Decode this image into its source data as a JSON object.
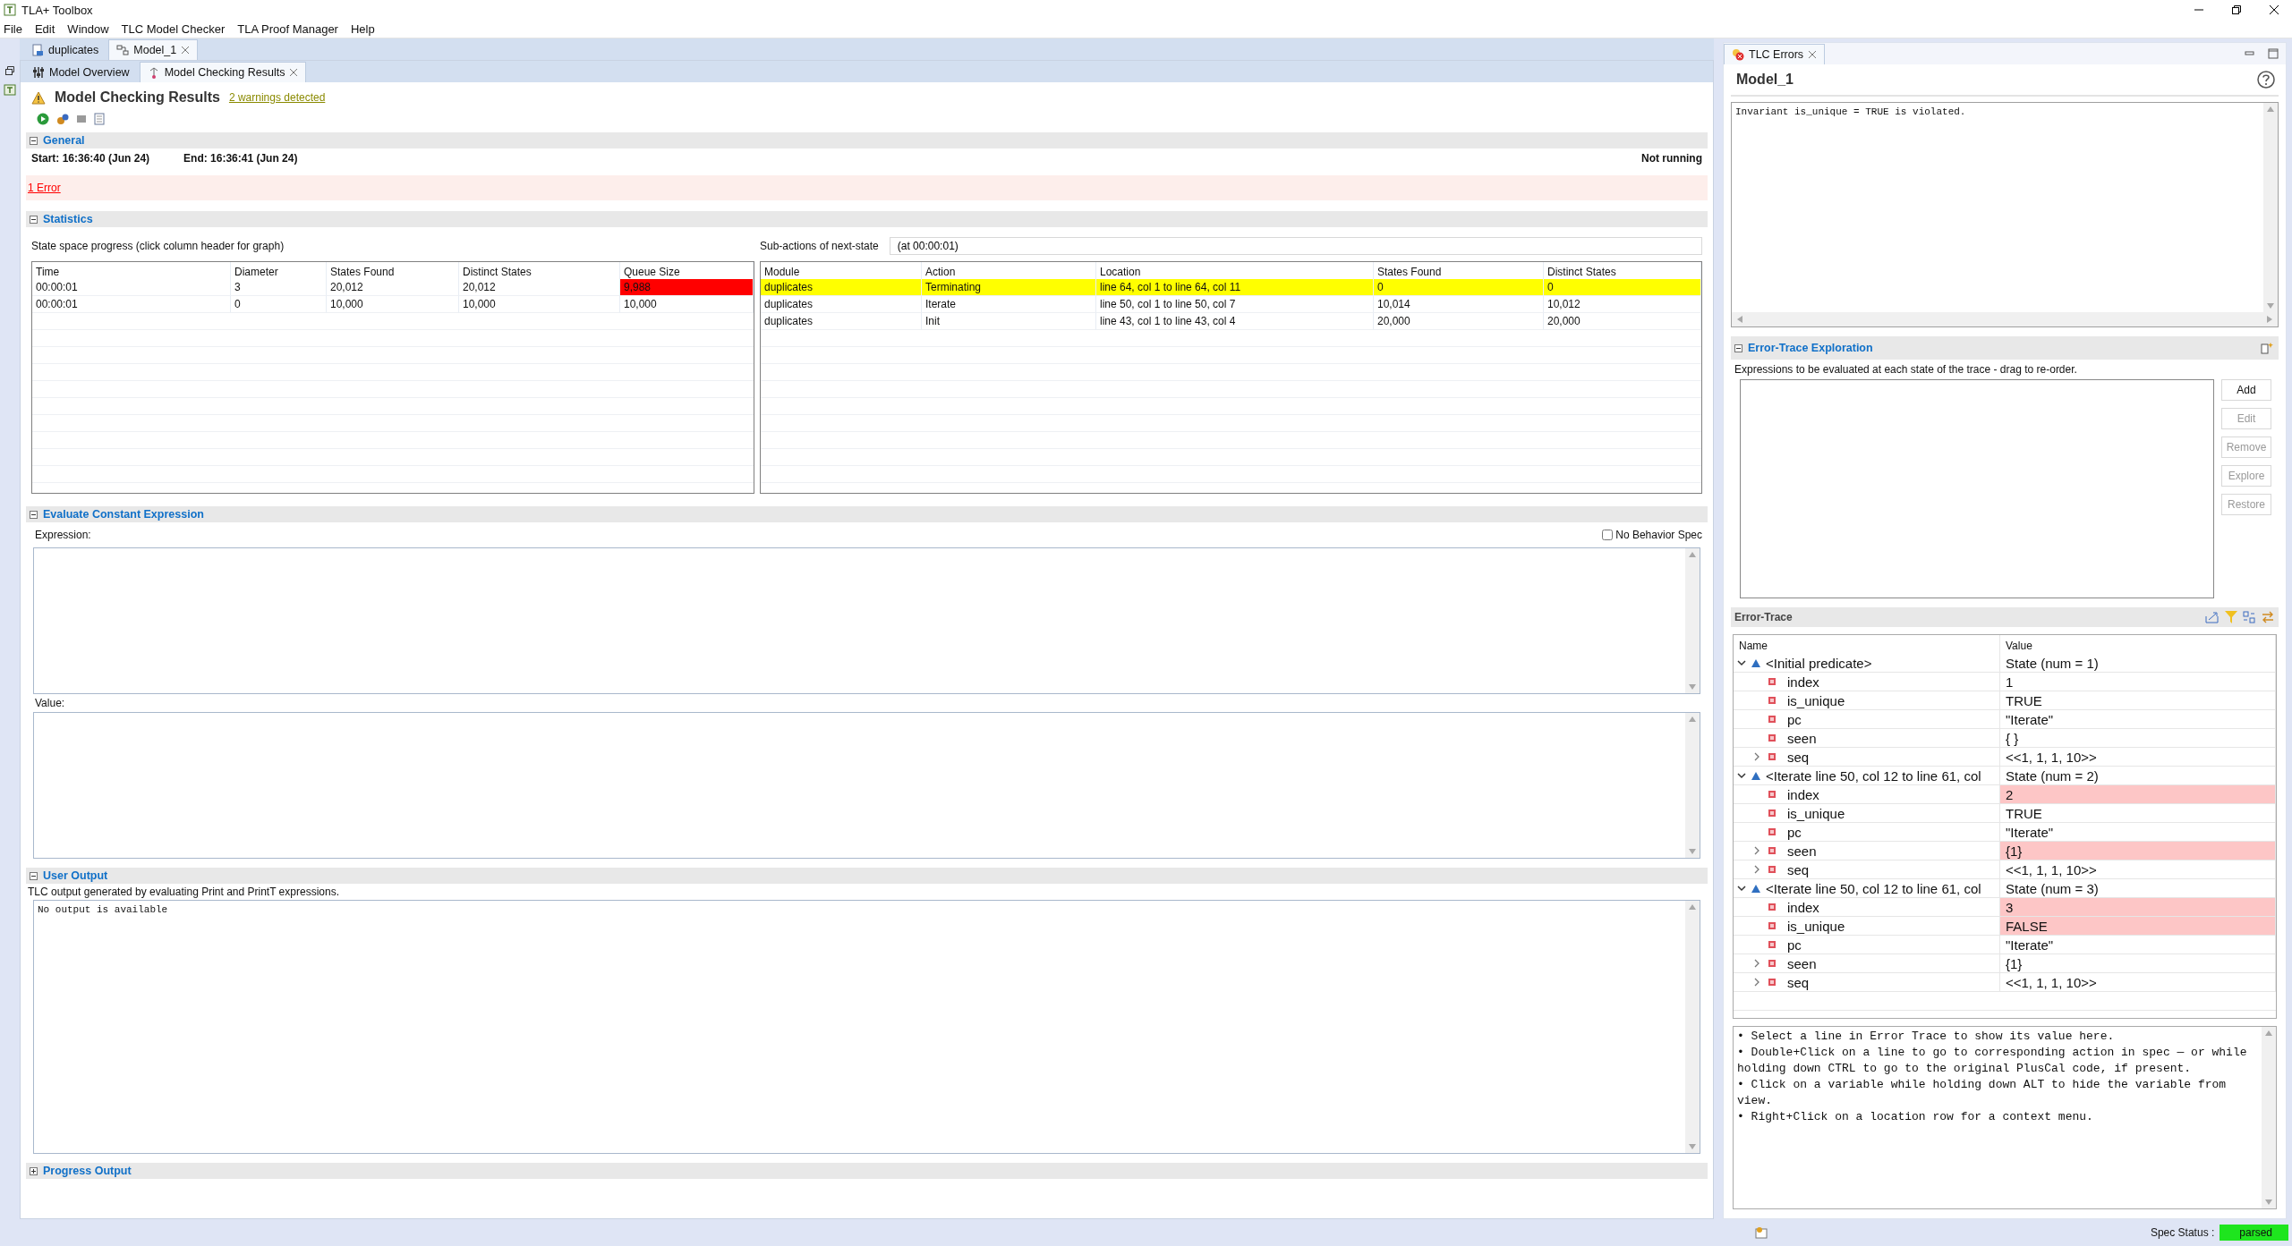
{
  "window": {
    "title": "TLA+ Toolbox"
  },
  "menu": [
    "File",
    "Edit",
    "Window",
    "TLC Model Checker",
    "TLA Proof Manager",
    "Help"
  ],
  "editor_tabs": [
    {
      "label": "duplicates",
      "selected": false,
      "kind": "spec"
    },
    {
      "label": "Model_1",
      "selected": true,
      "kind": "model"
    }
  ],
  "page_tabs": [
    {
      "label": "Model Overview",
      "selected": false,
      "kind": "overview"
    },
    {
      "label": "Model Checking Results",
      "selected": true,
      "kind": "results"
    }
  ],
  "results": {
    "title": "Model Checking Results",
    "warnings_link": "2 warnings detected"
  },
  "general": {
    "title": "General",
    "expanded": true,
    "start": "Start: 16:36:40 (Jun 24)",
    "end": "End: 16:36:41 (Jun 24)",
    "status": "Not running",
    "errors_link": "1 Error"
  },
  "statistics": {
    "title": "Statistics",
    "expanded": true,
    "progress_label": "State space progress (click column header for graph)",
    "progress_table": {
      "columns": [
        "Time",
        "Diameter",
        "States Found",
        "Distinct States",
        "Queue Size"
      ],
      "rows": [
        {
          "cells": [
            {
              "text": "00:00:01",
              "alert": false
            },
            {
              "text": "3",
              "alert": false
            },
            {
              "text": "20,012",
              "alert": false
            },
            {
              "text": "20,012",
              "alert": false
            },
            {
              "text": "9,988",
              "alert": true
            }
          ]
        },
        {
          "cells": [
            {
              "text": "00:00:01",
              "alert": false
            },
            {
              "text": "0",
              "alert": false
            },
            {
              "text": "10,000",
              "alert": false
            },
            {
              "text": "10,000",
              "alert": false
            },
            {
              "text": "10,000",
              "alert": false
            }
          ]
        }
      ]
    },
    "subactions_label": "Sub-actions of next-state",
    "subactions_time": "(at 00:00:01)",
    "subactions_table": {
      "columns": [
        "Module",
        "Action",
        "Location",
        "States Found",
        "Distinct States"
      ],
      "rows": [
        {
          "highlighted": true,
          "cells": [
            "duplicates",
            "Terminating",
            "line 64, col 1 to line 64, col 11",
            "0",
            "0"
          ]
        },
        {
          "highlighted": false,
          "cells": [
            "duplicates",
            "Iterate",
            "line 50, col 1 to line 50, col 7",
            "10,014",
            "10,012"
          ]
        },
        {
          "highlighted": false,
          "cells": [
            "duplicates",
            "Init",
            "line 43, col 1 to line 43, col 4",
            "20,000",
            "20,000"
          ]
        }
      ]
    }
  },
  "evaluate": {
    "title": "Evaluate Constant Expression",
    "expanded": true,
    "expression_label": "Expression:",
    "no_behavior_spec": {
      "label": "No Behavior Spec",
      "checked": false
    },
    "value_label": "Value:"
  },
  "user_output": {
    "title": "User Output",
    "expanded": true,
    "description": "TLC output generated by evaluating Print and PrintT expressions.",
    "text": "No output is available"
  },
  "progress_output": {
    "title": "Progress Output",
    "expanded": false
  },
  "errors_view": {
    "tab": "TLC Errors",
    "model": "Model_1",
    "message": "Invariant is_unique = TRUE is violated.",
    "exploration": {
      "title": "Error-Trace Exploration",
      "expanded": true,
      "description": "Expressions to be evaluated at each state of the trace - drag to re-order.",
      "buttons": [
        {
          "label": "Add",
          "disabled": false
        },
        {
          "label": "Edit",
          "disabled": true
        },
        {
          "label": "Remove",
          "disabled": true
        },
        {
          "label": "Explore",
          "disabled": true
        },
        {
          "label": "Restore",
          "disabled": true
        }
      ]
    },
    "trace": {
      "title": "Error-Trace",
      "columns": [
        "Name",
        "Value"
      ],
      "states": [
        {
          "name": "<Initial predicate>",
          "value": "State (num = 1)",
          "expanded": true,
          "children": [
            {
              "name": "index",
              "value": "1",
              "changed": false,
              "expandable": false
            },
            {
              "name": "is_unique",
              "value": "TRUE",
              "changed": false,
              "expandable": false
            },
            {
              "name": "pc",
              "value": "\"Iterate\"",
              "changed": false,
              "expandable": false
            },
            {
              "name": "seen",
              "value": "{ }",
              "changed": false,
              "expandable": false
            },
            {
              "name": "seq",
              "value": "<<1, 1, 1, 10>>",
              "changed": false,
              "expandable": true
            }
          ]
        },
        {
          "name": "<Iterate line 50, col 12 to line 61, col",
          "value": "State (num = 2)",
          "expanded": true,
          "children": [
            {
              "name": "index",
              "value": "2",
              "changed": true,
              "expandable": false
            },
            {
              "name": "is_unique",
              "value": "TRUE",
              "changed": false,
              "expandable": false
            },
            {
              "name": "pc",
              "value": "\"Iterate\"",
              "changed": false,
              "expandable": false
            },
            {
              "name": "seen",
              "value": "{1}",
              "changed": true,
              "expandable": true
            },
            {
              "name": "seq",
              "value": "<<1, 1, 1, 10>>",
              "changed": false,
              "expandable": true
            }
          ]
        },
        {
          "name": "<Iterate line 50, col 12 to line 61, col",
          "value": "State (num = 3)",
          "expanded": true,
          "children": [
            {
              "name": "index",
              "value": "3",
              "changed": true,
              "expandable": false
            },
            {
              "name": "is_unique",
              "value": "FALSE",
              "changed": true,
              "expandable": false
            },
            {
              "name": "pc",
              "value": "\"Iterate\"",
              "changed": false,
              "expandable": false
            },
            {
              "name": "seen",
              "value": "{1}",
              "changed": false,
              "expandable": true
            },
            {
              "name": "seq",
              "value": "<<1, 1, 1, 10>>",
              "changed": false,
              "expandable": true
            }
          ]
        }
      ]
    },
    "help": [
      "• Select a line in Error Trace to show its value here.",
      "• Double+Click on a line to go to corresponding action in spec — or while holding down CTRL to go to the original PlusCal code, if present.",
      "• Click on a variable while holding down ALT to hide the variable from view.",
      "• Right+Click on a location row for a context menu."
    ]
  },
  "status_bar": {
    "label": "Spec Status :",
    "value": "parsed"
  }
}
